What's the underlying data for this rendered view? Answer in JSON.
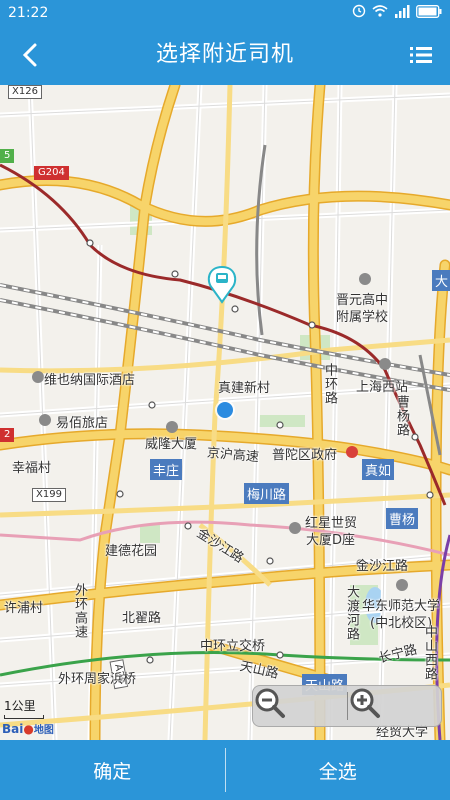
{
  "status_bar": {
    "time": "21:22"
  },
  "header": {
    "title": "选择附近司机"
  },
  "map": {
    "shields": {
      "x126": "X126",
      "g204": "G204",
      "x199": "X199",
      "a20": "A20",
      "s5": "5",
      "s2": "2"
    },
    "places": {
      "weiyena": "维也纳国际酒店",
      "yibai": "易佰旅店",
      "xingfucun": "幸福村",
      "jiande": "建德花园",
      "xupucun": "许浦村",
      "waihuan_zhoujia": "外环周家浜桥",
      "zhenjian": "真建新村",
      "weilong": "威隆大厦",
      "jinghu": "京沪高速",
      "putuo_gov": "普陀区政府",
      "jinyuan": "晋元高中",
      "fushu": "附属学校",
      "shanghai_west": "上海西站",
      "hongxing": "红星世贸",
      "dasha_d": "大厦D座",
      "jinshajiang_road": "金沙江路",
      "jinshajiang_road2": "金沙江路",
      "beizhai": "北翟路",
      "zhonghuan_li": "中环立交桥",
      "tianshan": "天山路",
      "ecnu": "华东师范大学",
      "ecnu_zhongbei": "(中北校区)",
      "changning": "长宁路",
      "jingmao": "经贸大学",
      "waihuan_gaosu": "外环高速",
      "zhonghuan_road": "中环路",
      "caoyang_road": "曹杨路",
      "zhongshan": "中山西路",
      "dadu_river": "大渡河路"
    },
    "districts": {
      "fengzhuang": "丰庄",
      "meichuan": "梅川路",
      "zhenru": "真如",
      "caoyang": "曹杨",
      "tianshan_d": "天山路",
      "da": "大"
    },
    "scale_text": "1公里",
    "logo_text": "Bai",
    "logo_suffix": "地图"
  },
  "footer": {
    "confirm": "确定",
    "select_all": "全选"
  },
  "colors": {
    "primary": "#2b95d8",
    "highway": "#f7c53a",
    "road": "#ffffff",
    "metro_red": "#9b2a2a",
    "metro_green": "#3aa34a",
    "metro_purple": "#7b3fa8",
    "location_dot": "#2b8be0"
  }
}
